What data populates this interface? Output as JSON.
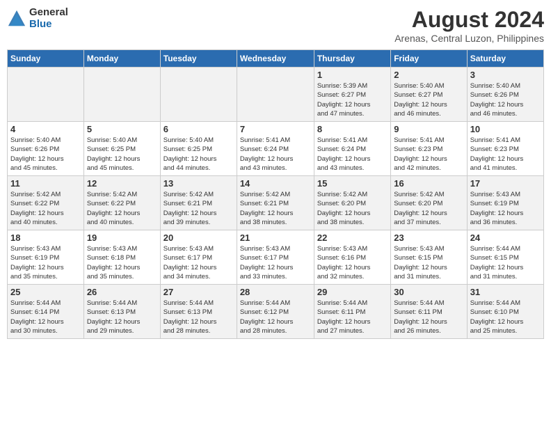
{
  "header": {
    "logo_general": "General",
    "logo_blue": "Blue",
    "title": "August 2024",
    "subtitle": "Arenas, Central Luzon, Philippines"
  },
  "days_of_week": [
    "Sunday",
    "Monday",
    "Tuesday",
    "Wednesday",
    "Thursday",
    "Friday",
    "Saturday"
  ],
  "weeks": [
    [
      {
        "day": "",
        "info": ""
      },
      {
        "day": "",
        "info": ""
      },
      {
        "day": "",
        "info": ""
      },
      {
        "day": "",
        "info": ""
      },
      {
        "day": "1",
        "info": "Sunrise: 5:39 AM\nSunset: 6:27 PM\nDaylight: 12 hours\nand 47 minutes."
      },
      {
        "day": "2",
        "info": "Sunrise: 5:40 AM\nSunset: 6:27 PM\nDaylight: 12 hours\nand 46 minutes."
      },
      {
        "day": "3",
        "info": "Sunrise: 5:40 AM\nSunset: 6:26 PM\nDaylight: 12 hours\nand 46 minutes."
      }
    ],
    [
      {
        "day": "4",
        "info": "Sunrise: 5:40 AM\nSunset: 6:26 PM\nDaylight: 12 hours\nand 45 minutes."
      },
      {
        "day": "5",
        "info": "Sunrise: 5:40 AM\nSunset: 6:25 PM\nDaylight: 12 hours\nand 45 minutes."
      },
      {
        "day": "6",
        "info": "Sunrise: 5:40 AM\nSunset: 6:25 PM\nDaylight: 12 hours\nand 44 minutes."
      },
      {
        "day": "7",
        "info": "Sunrise: 5:41 AM\nSunset: 6:24 PM\nDaylight: 12 hours\nand 43 minutes."
      },
      {
        "day": "8",
        "info": "Sunrise: 5:41 AM\nSunset: 6:24 PM\nDaylight: 12 hours\nand 43 minutes."
      },
      {
        "day": "9",
        "info": "Sunrise: 5:41 AM\nSunset: 6:23 PM\nDaylight: 12 hours\nand 42 minutes."
      },
      {
        "day": "10",
        "info": "Sunrise: 5:41 AM\nSunset: 6:23 PM\nDaylight: 12 hours\nand 41 minutes."
      }
    ],
    [
      {
        "day": "11",
        "info": "Sunrise: 5:42 AM\nSunset: 6:22 PM\nDaylight: 12 hours\nand 40 minutes."
      },
      {
        "day": "12",
        "info": "Sunrise: 5:42 AM\nSunset: 6:22 PM\nDaylight: 12 hours\nand 40 minutes."
      },
      {
        "day": "13",
        "info": "Sunrise: 5:42 AM\nSunset: 6:21 PM\nDaylight: 12 hours\nand 39 minutes."
      },
      {
        "day": "14",
        "info": "Sunrise: 5:42 AM\nSunset: 6:21 PM\nDaylight: 12 hours\nand 38 minutes."
      },
      {
        "day": "15",
        "info": "Sunrise: 5:42 AM\nSunset: 6:20 PM\nDaylight: 12 hours\nand 38 minutes."
      },
      {
        "day": "16",
        "info": "Sunrise: 5:42 AM\nSunset: 6:20 PM\nDaylight: 12 hours\nand 37 minutes."
      },
      {
        "day": "17",
        "info": "Sunrise: 5:43 AM\nSunset: 6:19 PM\nDaylight: 12 hours\nand 36 minutes."
      }
    ],
    [
      {
        "day": "18",
        "info": "Sunrise: 5:43 AM\nSunset: 6:19 PM\nDaylight: 12 hours\nand 35 minutes."
      },
      {
        "day": "19",
        "info": "Sunrise: 5:43 AM\nSunset: 6:18 PM\nDaylight: 12 hours\nand 35 minutes."
      },
      {
        "day": "20",
        "info": "Sunrise: 5:43 AM\nSunset: 6:17 PM\nDaylight: 12 hours\nand 34 minutes."
      },
      {
        "day": "21",
        "info": "Sunrise: 5:43 AM\nSunset: 6:17 PM\nDaylight: 12 hours\nand 33 minutes."
      },
      {
        "day": "22",
        "info": "Sunrise: 5:43 AM\nSunset: 6:16 PM\nDaylight: 12 hours\nand 32 minutes."
      },
      {
        "day": "23",
        "info": "Sunrise: 5:43 AM\nSunset: 6:15 PM\nDaylight: 12 hours\nand 31 minutes."
      },
      {
        "day": "24",
        "info": "Sunrise: 5:44 AM\nSunset: 6:15 PM\nDaylight: 12 hours\nand 31 minutes."
      }
    ],
    [
      {
        "day": "25",
        "info": "Sunrise: 5:44 AM\nSunset: 6:14 PM\nDaylight: 12 hours\nand 30 minutes."
      },
      {
        "day": "26",
        "info": "Sunrise: 5:44 AM\nSunset: 6:13 PM\nDaylight: 12 hours\nand 29 minutes."
      },
      {
        "day": "27",
        "info": "Sunrise: 5:44 AM\nSunset: 6:13 PM\nDaylight: 12 hours\nand 28 minutes."
      },
      {
        "day": "28",
        "info": "Sunrise: 5:44 AM\nSunset: 6:12 PM\nDaylight: 12 hours\nand 28 minutes."
      },
      {
        "day": "29",
        "info": "Sunrise: 5:44 AM\nSunset: 6:11 PM\nDaylight: 12 hours\nand 27 minutes."
      },
      {
        "day": "30",
        "info": "Sunrise: 5:44 AM\nSunset: 6:11 PM\nDaylight: 12 hours\nand 26 minutes."
      },
      {
        "day": "31",
        "info": "Sunrise: 5:44 AM\nSunset: 6:10 PM\nDaylight: 12 hours\nand 25 minutes."
      }
    ]
  ]
}
